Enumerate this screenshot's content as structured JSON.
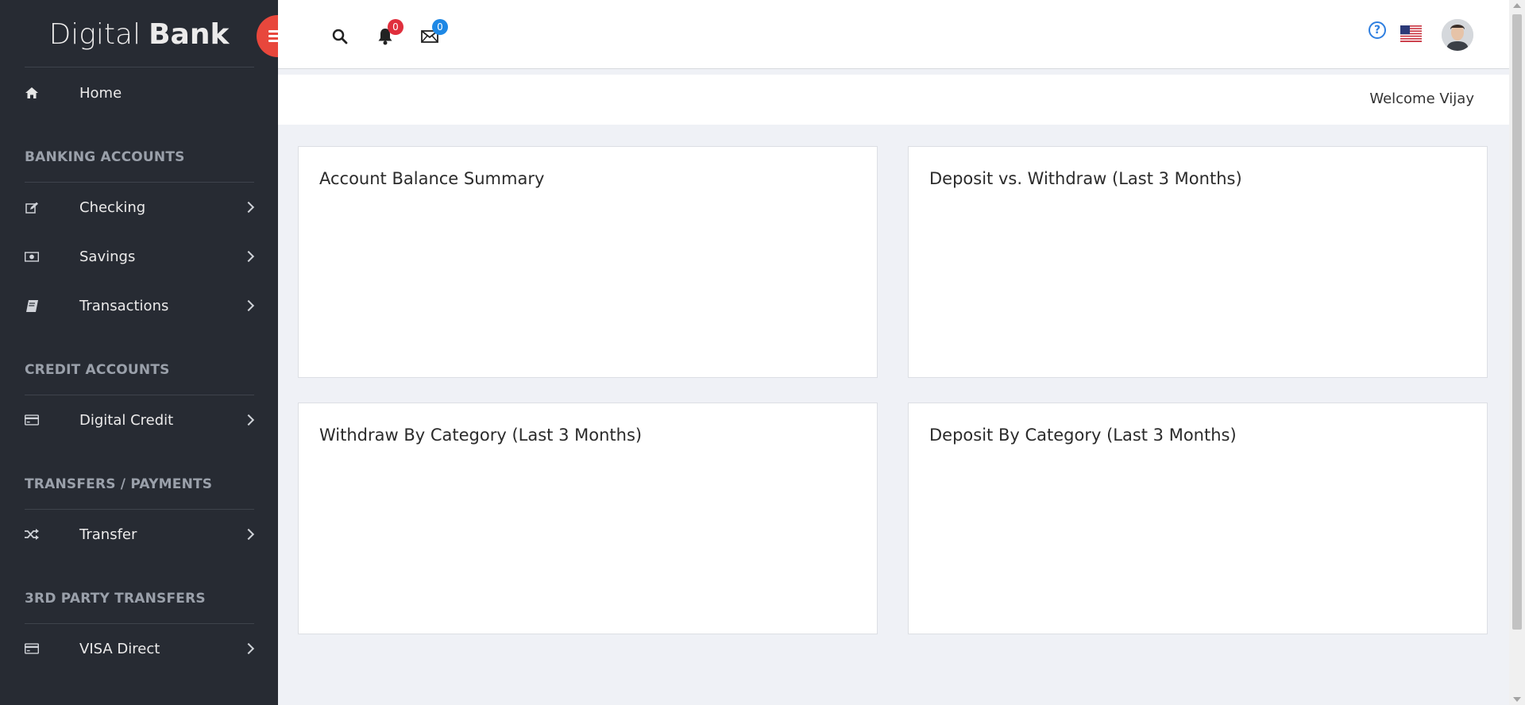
{
  "brand": {
    "light": "Digital",
    "bold": "Bank"
  },
  "sidebar": {
    "home": "Home",
    "sections": [
      {
        "title": "BANKING ACCOUNTS"
      },
      {
        "title": "CREDIT ACCOUNTS"
      },
      {
        "title": "TRANSFERS / PAYMENTS"
      },
      {
        "title": "3RD PARTY TRANSFERS"
      }
    ],
    "items": {
      "checking": "Checking",
      "savings": "Savings",
      "transactions": "Transactions",
      "digital_credit": "Digital Credit",
      "transfer": "Transfer",
      "visa_direct": "VISA Direct"
    }
  },
  "topbar": {
    "notifications_count": "0",
    "messages_count": "0",
    "help": "?"
  },
  "welcome": "Welcome Vijay",
  "cards": [
    {
      "title": "Account Balance Summary"
    },
    {
      "title": "Deposit vs. Withdraw (Last 3 Months)"
    },
    {
      "title": "Withdraw By Category (Last 3 Months)"
    },
    {
      "title": "Deposit By Category (Last 3 Months)"
    }
  ],
  "colors": {
    "sidebar_bg": "#272b33",
    "accent_red": "#e8473c",
    "notification_badge": "#e02f3d",
    "message_badge": "#1e88e5",
    "help_blue": "#2f7fe0"
  }
}
